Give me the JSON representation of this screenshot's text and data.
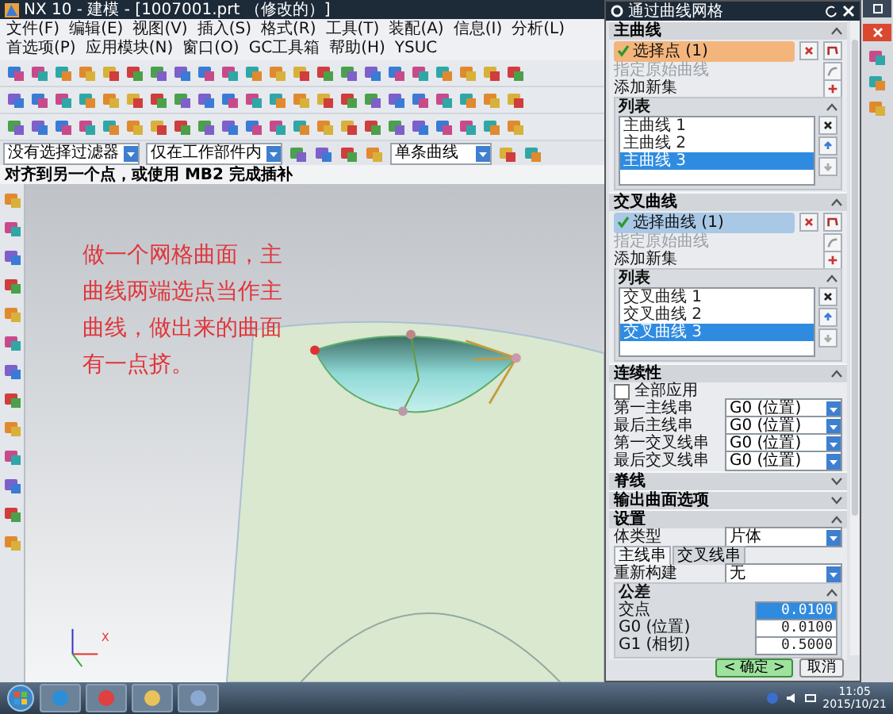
{
  "window": {
    "title": "NX 10 - 建模 - [1007001.prt （修改的）]"
  },
  "menu": [
    "文件(F)",
    "编辑(E)",
    "视图(V)",
    "插入(S)",
    "格式(R)",
    "工具(T)",
    "装配(A)",
    "信息(I)",
    "分析(L)",
    "首选项(P)",
    "应用模块(N)",
    "窗口(O)",
    "GC工具箱",
    "帮助(H)",
    "YSUC"
  ],
  "filter_bar": {
    "selection_filter": "没有选择过滤器",
    "scope": "仅在工作部件内",
    "curve_rule": "单条曲线"
  },
  "status_line": "对齐到另一个点，或使用 MB2 完成插补",
  "canvas": {
    "annotation": "做一个网格曲面，主曲线两端选点当作主曲线，做出来的曲面有一点挤。",
    "axis_label": "X"
  },
  "dialog": {
    "title": "通过曲线网格",
    "sections": [
      {
        "kind": "curves",
        "title": "主曲线",
        "expanded": true,
        "selector": {
          "label": "选择点 (1)",
          "color": "#f3b57c"
        },
        "original_curve": {
          "label": "指定原始曲线",
          "disabled": true
        },
        "add_set": "添加新集",
        "list_title": "列表",
        "items": [
          {
            "label": "主曲线 1",
            "selected": false
          },
          {
            "label": "主曲线 2",
            "selected": false
          },
          {
            "label": "主曲线 3",
            "selected": true
          }
        ]
      },
      {
        "kind": "curves",
        "title": "交叉曲线",
        "expanded": true,
        "selector": {
          "label": "选择曲线 (1)",
          "color": "#a9c8e6"
        },
        "original_curve": {
          "label": "指定原始曲线",
          "disabled": true
        },
        "add_set": "添加新集",
        "list_title": "列表",
        "items": [
          {
            "label": "交叉曲线 1",
            "selected": false
          },
          {
            "label": "交叉曲线 2",
            "selected": false
          },
          {
            "label": "交叉曲线 3",
            "selected": true
          }
        ]
      },
      {
        "kind": "continuity",
        "title": "连续性",
        "expanded": true,
        "apply_all": {
          "label": "全部应用",
          "checked": false
        },
        "rows": [
          {
            "label": "第一主线串",
            "value": "G0 (位置)"
          },
          {
            "label": "最后主线串",
            "value": "G0 (位置)"
          },
          {
            "label": "第一交叉线串",
            "value": "G0 (位置)"
          },
          {
            "label": "最后交叉线串",
            "value": "G0 (位置)"
          }
        ]
      },
      {
        "kind": "plain",
        "title": "脊线",
        "expanded": false
      },
      {
        "kind": "plain",
        "title": "输出曲面选项",
        "expanded": false
      },
      {
        "kind": "settings",
        "title": "设置",
        "expanded": true,
        "body_type": {
          "label": "体类型",
          "value": "片体"
        },
        "tabs": [
          {
            "label": "主线串",
            "selected": true
          },
          {
            "label": "交叉线串",
            "selected": false
          }
        ],
        "rebuild": {
          "label": "重新构建",
          "value": "无"
        },
        "tolerance": {
          "title": "公差",
          "fields": [
            {
              "label": "交点",
              "value": "0.0100",
              "selected": true
            },
            {
              "label": "G0 (位置)",
              "value": "0.0100",
              "selected": false
            },
            {
              "label": "G1 (相切)",
              "value": "0.5000",
              "selected": false
            }
          ]
        }
      }
    ],
    "buttons": [
      {
        "label": "< 确定 >",
        "kind": "primary"
      },
      {
        "label": "取消",
        "kind": "normal"
      }
    ]
  },
  "taskbar": {
    "time": "11:05",
    "date": "2015/10/21"
  }
}
